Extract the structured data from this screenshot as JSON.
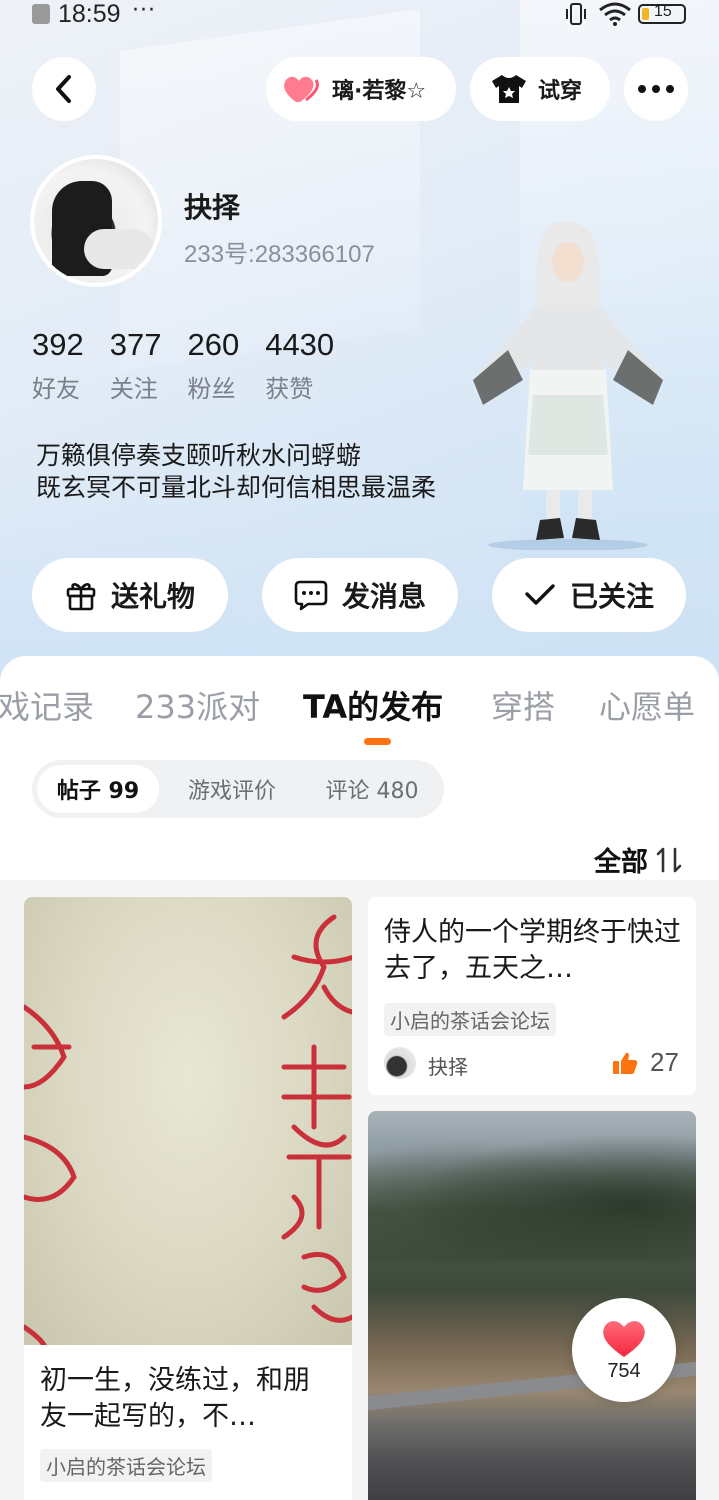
{
  "status_bar": {
    "time": "18:59",
    "more": "···",
    "battery_level": "15"
  },
  "header": {
    "badge_label": "璃·若黎☆",
    "try_on_label": "试穿"
  },
  "profile": {
    "name": "抉择",
    "id": "233号:283366107",
    "stats": [
      {
        "value": "392",
        "label": "好友"
      },
      {
        "value": "377",
        "label": "关注"
      },
      {
        "value": "260",
        "label": "粉丝"
      },
      {
        "value": "4430",
        "label": "获赞"
      }
    ],
    "bio_line1": "万籁俱停奏支颐听秋水问蜉蝣",
    "bio_line2": "既玄冥不可量北斗却何信相思最温柔"
  },
  "actions": {
    "gift": "送礼物",
    "message": "发消息",
    "follow": "已关注"
  },
  "tabs": [
    {
      "label": "戏记录"
    },
    {
      "label": "233派对"
    },
    {
      "label": "TA的发布"
    },
    {
      "label": "穿搭"
    },
    {
      "label": "心愿单"
    }
  ],
  "active_tab": "TA的发布",
  "segments": [
    {
      "label": "帖子 99"
    },
    {
      "label": "游戏评价"
    },
    {
      "label": "评论 480"
    }
  ],
  "sort_label": "全部",
  "posts": {
    "left": {
      "title": "初一生，没练过，和朋友一起写的，不…",
      "forum": "小启的茶话会论坛"
    },
    "right1": {
      "title": "侍人的一个学期终于快过去了，五天之…",
      "forum": "小启的茶话会论坛",
      "author": "抉择",
      "likes": "27"
    }
  },
  "fab": {
    "count": "754"
  },
  "colors": {
    "accent": "#ff7210",
    "heart": "#ff4d5e"
  }
}
